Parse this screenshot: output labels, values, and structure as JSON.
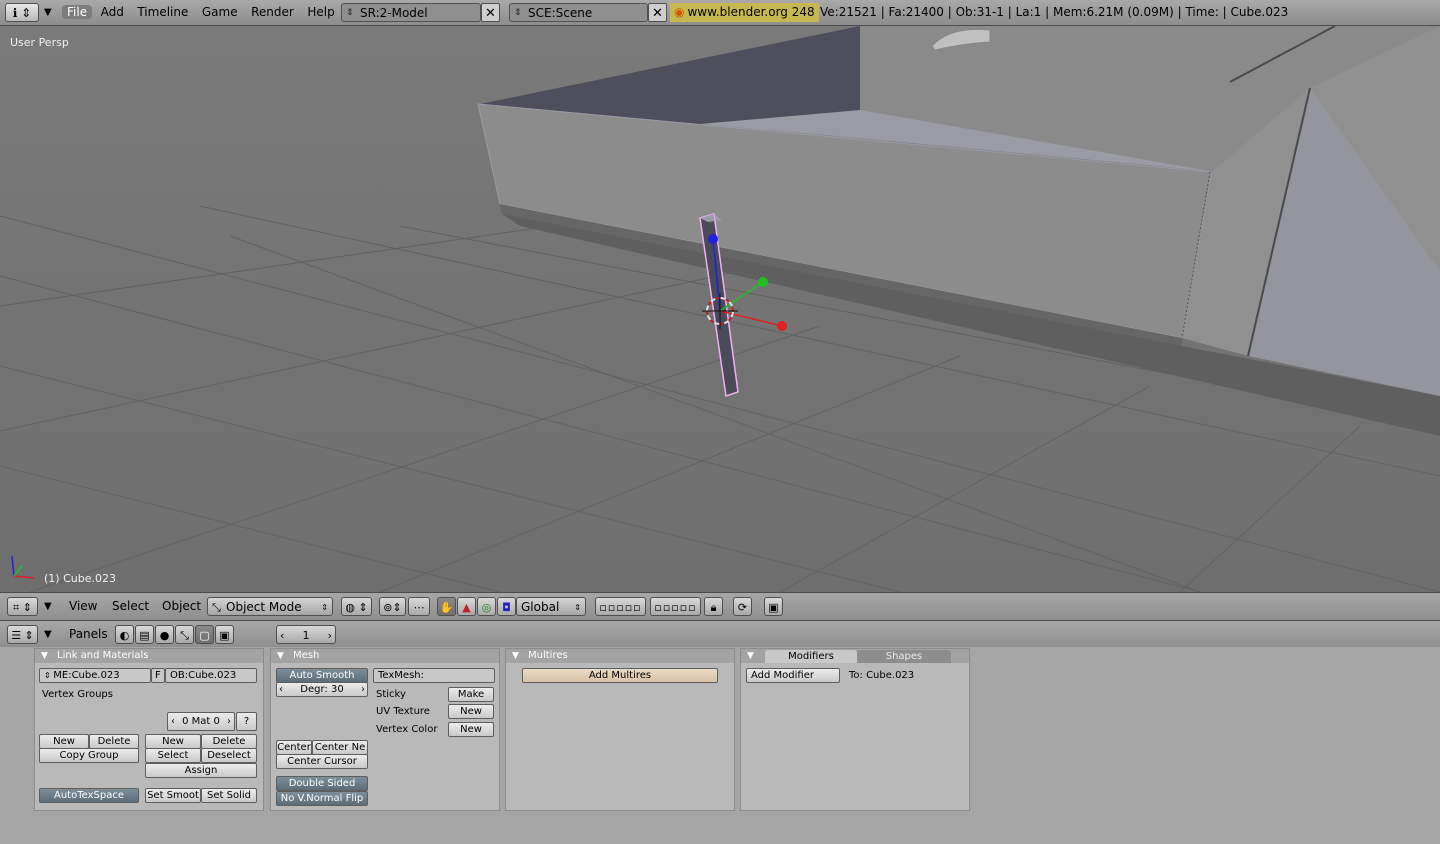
{
  "topbar": {
    "menus": [
      "File",
      "Add",
      "Timeline",
      "Game",
      "Render",
      "Help"
    ],
    "screen_field": "SR:2-Model",
    "scene_field": "SCE:Scene",
    "url": "www.blender.org 248",
    "stats": "Ve:21521 | Fa:21400 | Ob:31-1 | La:1  | Mem:6.21M (0.09M)  | Time: | Cube.023"
  },
  "viewport": {
    "view_label": "User Persp",
    "object_label": "(1) Cube.023"
  },
  "view_header": {
    "menus": [
      "View",
      "Select",
      "Object"
    ],
    "mode": "Object Mode",
    "orientation": "Global"
  },
  "buttons_header": {
    "panels_label": "Panels",
    "frame": "1"
  },
  "panels": {
    "link_materials": {
      "title": "Link and Materials",
      "me_field": "ME:Cube.023",
      "f_label": "F",
      "ob_field": "OB:Cube.023",
      "vertex_groups": "Vertex Groups",
      "mat": "0 Mat 0",
      "question": "?",
      "new": "New",
      "delete": "Delete",
      "copy_group": "Copy Group",
      "new2": "New",
      "delete2": "Delete",
      "select": "Select",
      "deselect": "Deselect",
      "assign": "Assign",
      "autotexspace": "AutoTexSpace",
      "set_smooth": "Set Smoot",
      "set_solid": "Set Solid"
    },
    "mesh": {
      "title": "Mesh",
      "auto_smooth": "Auto Smooth",
      "degr": "Degr: 30",
      "texmesh": "TexMesh:",
      "sticky": "Sticky",
      "make": "Make",
      "uv_texture": "UV Texture",
      "new_uv": "New",
      "vertex_color": "Vertex Color",
      "new_vc": "New",
      "center": "Center",
      "center_new": "Center Ne",
      "center_cursor": "Center Cursor",
      "double_sided": "Double Sided",
      "no_vnormal_flip": "No V.Normal Flip"
    },
    "multires": {
      "title": "Multires",
      "add_multires": "Add Multires"
    },
    "modifiers": {
      "tab_modifiers": "Modifiers",
      "tab_shapes": "Shapes",
      "add_modifier": "Add Modifier",
      "to_label": "To: Cube.023"
    }
  },
  "colors": {
    "accent_x": "#e02020",
    "accent_y": "#20c020",
    "accent_z": "#2020e0",
    "selection": "#f0b0f0",
    "url_bg": "#c6b84e"
  }
}
